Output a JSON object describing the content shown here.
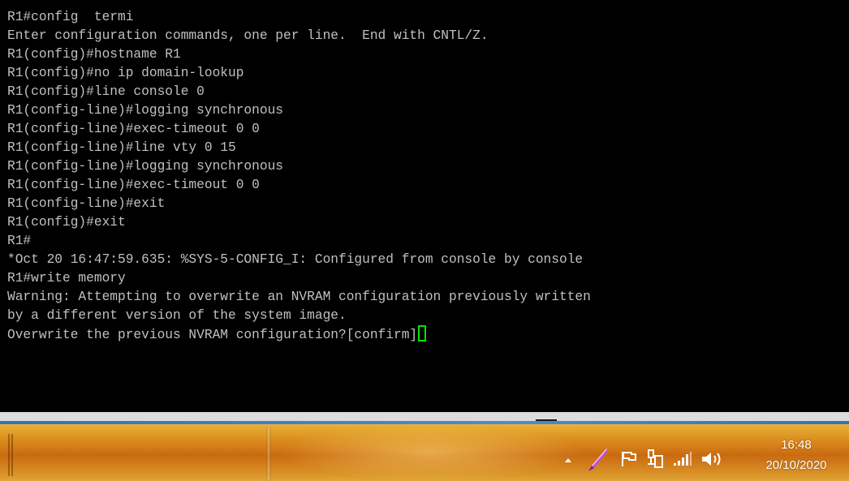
{
  "terminal": {
    "lines": [
      "R1#config  termi",
      "Enter configuration commands, one per line.  End with CNTL/Z.",
      "R1(config)#hostname R1",
      "R1(config)#no ip domain-lookup",
      "R1(config)#line console 0",
      "R1(config-line)#logging synchronous",
      "R1(config-line)#exec-timeout 0 0",
      "R1(config-line)#line vty 0 15",
      "R1(config-line)#logging synchronous",
      "R1(config-line)#exec-timeout 0 0",
      "R1(config-line)#exit",
      "R1(config)#exit",
      "R1#",
      "*Oct 20 16:47:59.635: %SYS-5-CONFIG_I: Configured from console by console",
      "R1#write memory",
      "Warning: Attempting to overwrite an NVRAM configuration previously written",
      "by a different version of the system image.",
      "Overwrite the previous NVRAM configuration?[confirm]"
    ],
    "text_color": "#c0c0c0",
    "background_color": "#000000",
    "cursor_color": "#00e600"
  },
  "taskbar": {
    "tray_icons": [
      "show-hidden-icons-arrow-icon",
      "pen-icon",
      "action-center-flag-icon",
      "network-adapter-icon",
      "signal-strength-icon",
      "volume-icon"
    ],
    "clock": {
      "time": "16:48",
      "date": "20/10/2020"
    }
  }
}
